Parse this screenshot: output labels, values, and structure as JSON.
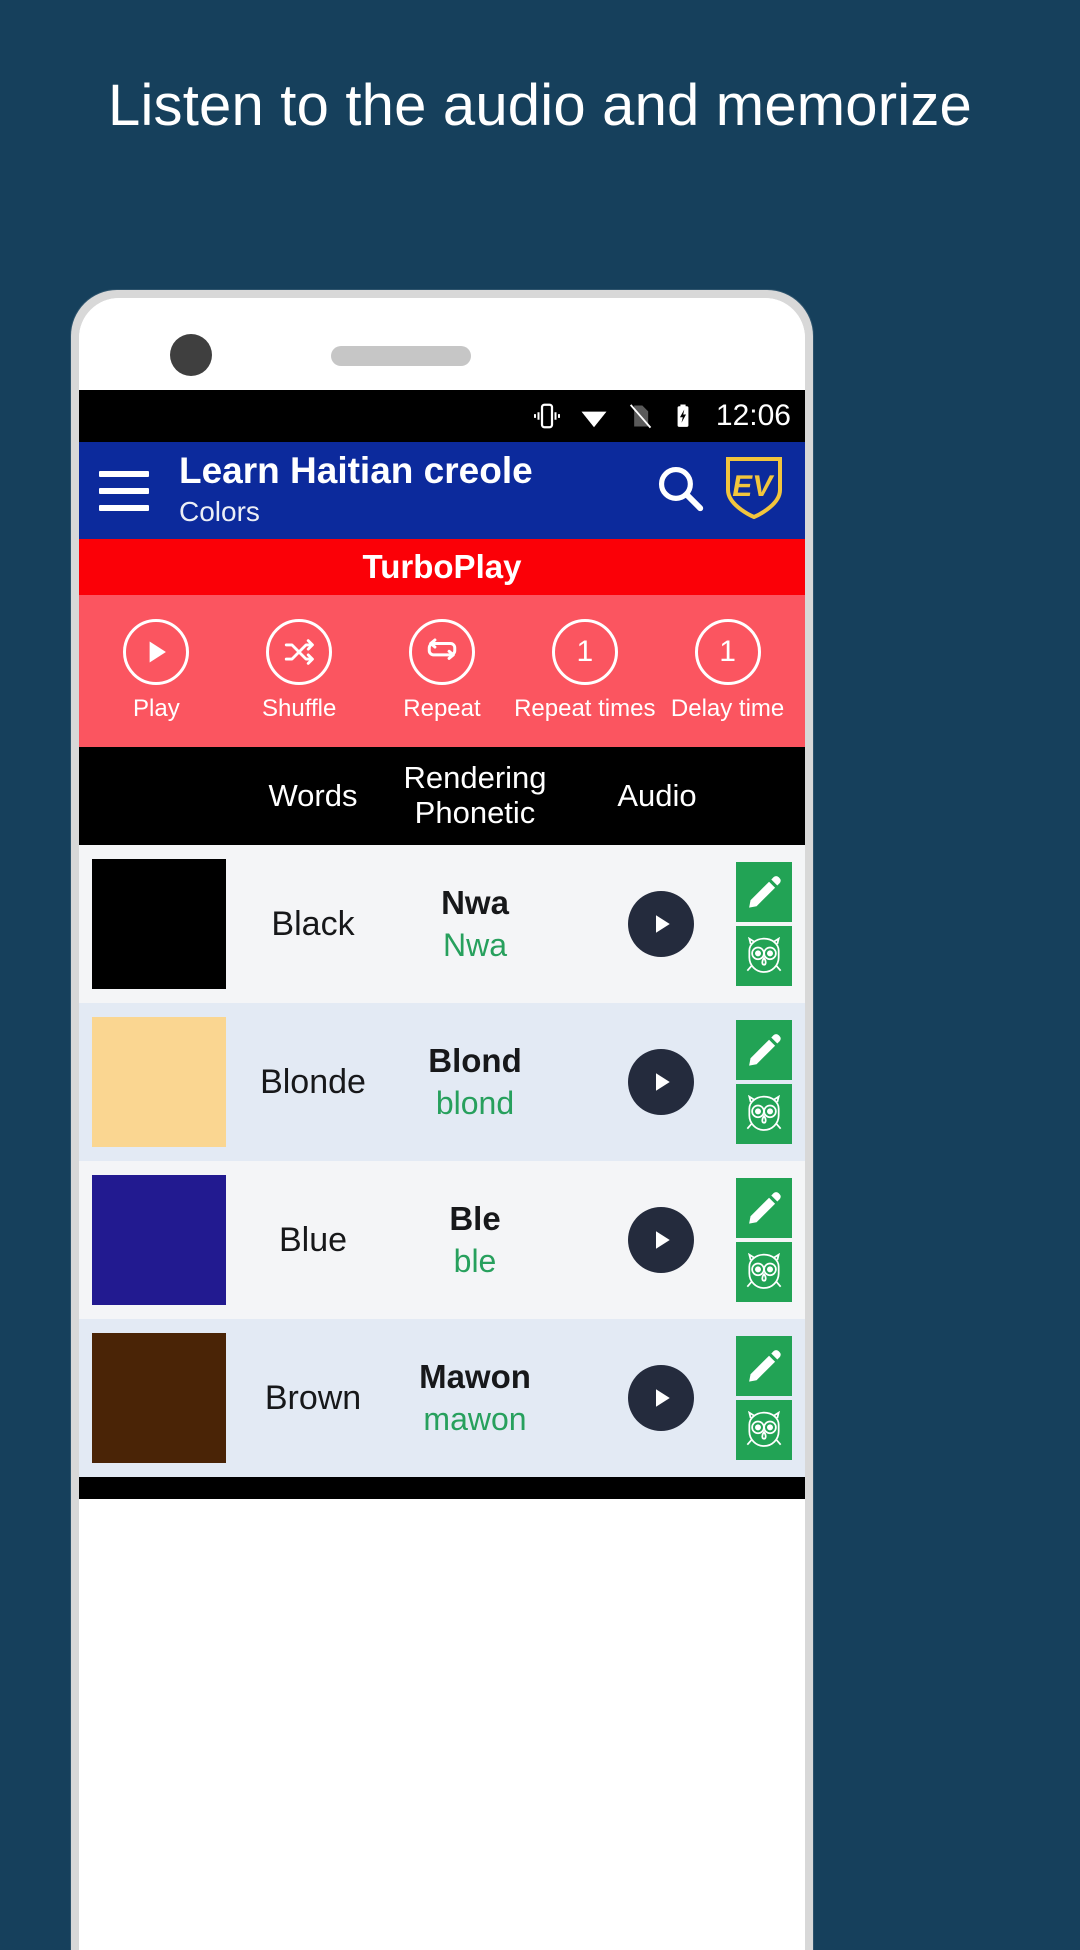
{
  "promo": {
    "headline": "Listen to the audio and memorize"
  },
  "statusbar": {
    "time": "12:06",
    "icons": [
      "vibrate-icon",
      "wifi-icon",
      "no-sim-icon",
      "battery-charging-icon"
    ]
  },
  "appbar": {
    "menu_icon": "hamburger-menu-icon",
    "title": "Learn Haitian creole",
    "subtitle": "Colors",
    "search_icon": "search-icon",
    "logo_text": "EV",
    "background": "#0c2a9c"
  },
  "turboplay": {
    "title": "TurboPlay",
    "title_bg": "#fb0007",
    "controls_bg": "#fb5560",
    "controls": [
      {
        "label": "Play",
        "icon": "play-icon",
        "value": ""
      },
      {
        "label": "Shuffle",
        "icon": "shuffle-icon",
        "value": ""
      },
      {
        "label": "Repeat",
        "icon": "repeat-icon",
        "value": ""
      },
      {
        "label": "Repeat times",
        "icon": "number",
        "value": "1"
      },
      {
        "label": "Delay time",
        "icon": "number",
        "value": "1"
      }
    ]
  },
  "table": {
    "headers": {
      "swatch": "",
      "words": "Words",
      "rendering": "Rendering",
      "phonetic": "Phonetic",
      "audio": "Audio"
    },
    "rows": [
      {
        "word": "Black",
        "rendering": "Nwa",
        "phonetic": "Nwa",
        "swatch_color": "#000000",
        "play_icon": "play-icon",
        "edit_icon": "pencil-icon",
        "memorize_icon": "owl-icon"
      },
      {
        "word": "Blonde",
        "rendering": "Blond",
        "phonetic": "blond",
        "swatch_color": "#fad691",
        "play_icon": "play-icon",
        "edit_icon": "pencil-icon",
        "memorize_icon": "owl-icon"
      },
      {
        "word": "Blue",
        "rendering": "Ble",
        "phonetic": "ble",
        "swatch_color": "#221a90",
        "play_icon": "play-icon",
        "edit_icon": "pencil-icon",
        "memorize_icon": "owl-icon"
      },
      {
        "word": "Brown",
        "rendering": "Mawon",
        "phonetic": "mawon",
        "swatch_color": "#4a2406",
        "play_icon": "play-icon",
        "edit_icon": "pencil-icon",
        "memorize_icon": "owl-icon"
      }
    ]
  },
  "colors": {
    "page_bg": "#16405c",
    "phonetic_green": "#27a05d",
    "action_green": "#22a355",
    "row_alt": "#e3eaf4",
    "row_norm": "#f4f5f7"
  }
}
